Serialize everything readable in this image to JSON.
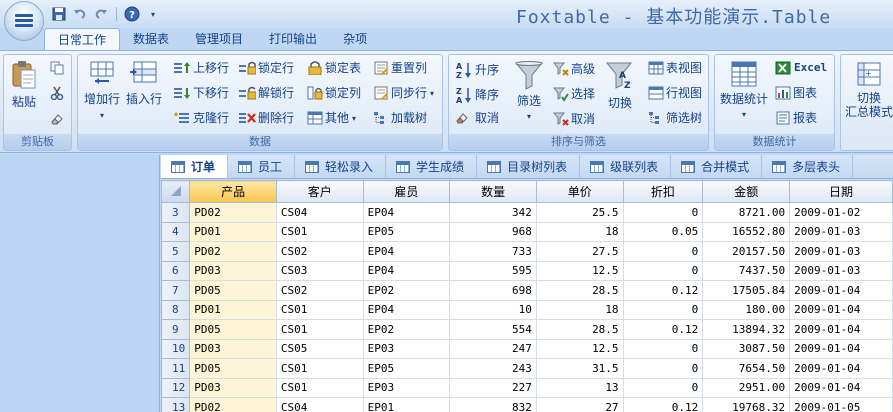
{
  "app": {
    "title": "Foxtable - 基本功能演示.Table"
  },
  "ribbon_tabs": [
    {
      "label": "日常工作",
      "active": true
    },
    {
      "label": "数据表",
      "active": false
    },
    {
      "label": "管理项目",
      "active": false
    },
    {
      "label": "打印输出",
      "active": false
    },
    {
      "label": "杂项",
      "active": false
    }
  ],
  "groups": {
    "clipboard": {
      "label": "剪贴板",
      "paste": "粘贴"
    },
    "data": {
      "label": "数据",
      "add_row": "增加行",
      "insert_row": "插入行",
      "move_up": "上移行",
      "move_down": "下移行",
      "clone": "克隆行",
      "lock_row": "锁定行",
      "unlock_row": "解锁行",
      "delete_row": "删除行",
      "lock_table": "锁定表",
      "lock_col": "锁定列",
      "other": "其他",
      "reset_col": "重置列",
      "sync_row": "同步行",
      "load_tree": "加载树"
    },
    "sort_filter": {
      "label": "排序与筛选",
      "asc": "升序",
      "desc": "降序",
      "cancel_sort": "取消",
      "filter": "筛选",
      "advanced": "高级",
      "select": "选择",
      "cancel_filter": "取消",
      "switch": "切换",
      "table_view": "表视图",
      "row_view": "行视图",
      "filter_tree": "筛选树"
    },
    "stats": {
      "label": "数据统计",
      "data_stats": "数据统计",
      "excel": "Excel",
      "chart": "图表",
      "report": "报表"
    },
    "switch_mode": {
      "label_line1": "切换",
      "label_line2": "汇总模式"
    }
  },
  "doc_tabs": [
    {
      "label": "订单",
      "active": true
    },
    {
      "label": "员工",
      "active": false
    },
    {
      "label": "轻松录入",
      "active": false
    },
    {
      "label": "学生成绩",
      "active": false
    },
    {
      "label": "目录树列表",
      "active": false
    },
    {
      "label": "级联列表",
      "active": false
    },
    {
      "label": "合并模式",
      "active": false
    },
    {
      "label": "多层表头",
      "active": false
    }
  ],
  "grid": {
    "columns": [
      "产品",
      "客户",
      "雇员",
      "数量",
      "单价",
      "折扣",
      "金额",
      "日期"
    ],
    "rows": [
      {
        "n": "3",
        "cells": [
          "PD02",
          "CS04",
          "EP04",
          "342",
          "25.5",
          "0",
          "8721.00",
          "2009-01-02"
        ]
      },
      {
        "n": "4",
        "cells": [
          "PD01",
          "CS01",
          "EP05",
          "968",
          "18",
          "0.05",
          "16552.80",
          "2009-01-03"
        ]
      },
      {
        "n": "5",
        "cells": [
          "PD02",
          "CS02",
          "EP04",
          "733",
          "27.5",
          "0",
          "20157.50",
          "2009-01-03"
        ]
      },
      {
        "n": "6",
        "cells": [
          "PD03",
          "CS03",
          "EP04",
          "595",
          "12.5",
          "0",
          "7437.50",
          "2009-01-03"
        ]
      },
      {
        "n": "7",
        "cells": [
          "PD05",
          "CS02",
          "EP02",
          "698",
          "28.5",
          "0.12",
          "17505.84",
          "2009-01-04"
        ]
      },
      {
        "n": "8",
        "cells": [
          "PD01",
          "CS01",
          "EP04",
          "10",
          "18",
          "0",
          "180.00",
          "2009-01-04"
        ]
      },
      {
        "n": "9",
        "cells": [
          "PD05",
          "CS01",
          "EP02",
          "554",
          "28.5",
          "0.12",
          "13894.32",
          "2009-01-04"
        ]
      },
      {
        "n": "10",
        "cells": [
          "PD03",
          "CS05",
          "EP03",
          "247",
          "12.5",
          "0",
          "3087.50",
          "2009-01-04"
        ]
      },
      {
        "n": "11",
        "cells": [
          "PD05",
          "CS01",
          "EP05",
          "243",
          "31.5",
          "0",
          "7654.50",
          "2009-01-04"
        ]
      },
      {
        "n": "12",
        "cells": [
          "PD03",
          "CS01",
          "EP03",
          "227",
          "13",
          "0",
          "2951.00",
          "2009-01-04"
        ]
      },
      {
        "n": "13",
        "cells": [
          "PD02",
          "CS04",
          "EP01",
          "832",
          "27",
          "0.12",
          "19768.32",
          "2009-01-05"
        ]
      }
    ]
  }
}
